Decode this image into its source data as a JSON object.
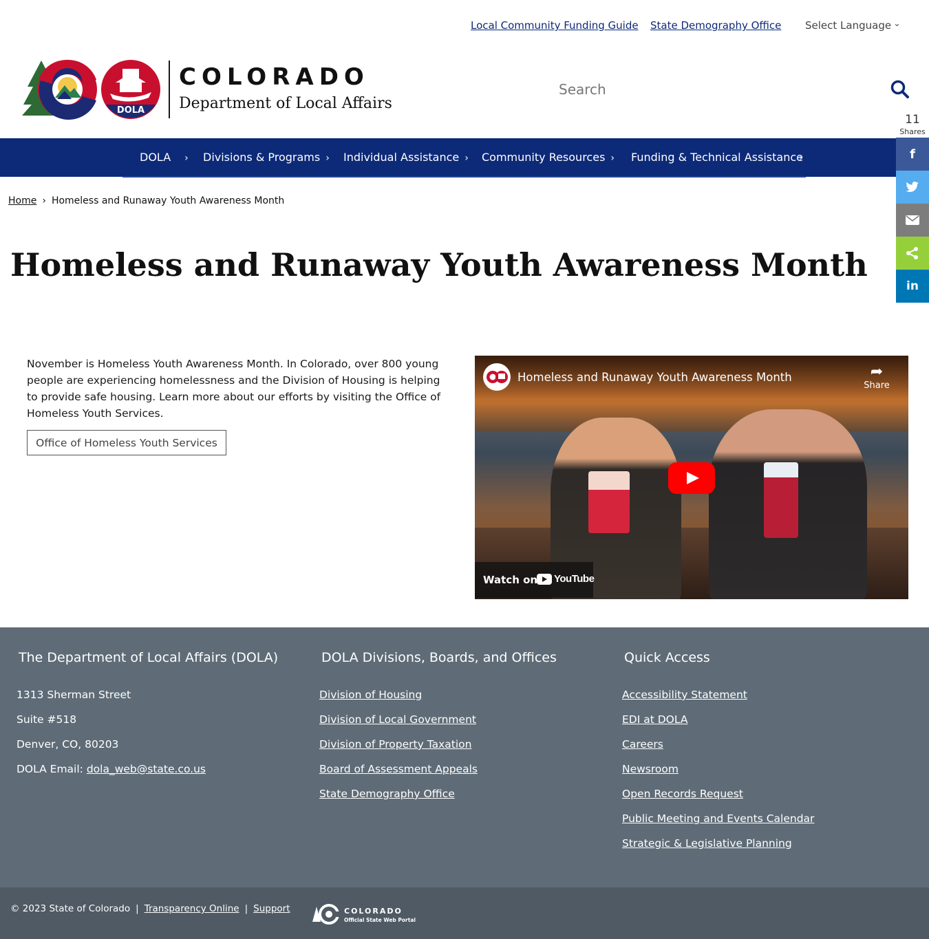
{
  "utility": {
    "link1": "Local Community Funding Guide",
    "link2": "State Demography Office",
    "language": "Select Language"
  },
  "header": {
    "brand_colorado": "COLORADO",
    "brand_department": "Department of Local Affairs",
    "badge_text": "DOLA",
    "search_placeholder": "Search"
  },
  "share": {
    "count": "11",
    "count_label": "Shares",
    "buttons": [
      {
        "name": "facebook",
        "color": "#3b5998",
        "glyph": "f"
      },
      {
        "name": "twitter",
        "color": "#55acee",
        "glyph": "t"
      },
      {
        "name": "email",
        "color": "#7d7d7d",
        "glyph": "✉"
      },
      {
        "name": "sharethis",
        "color": "#95d03a",
        "glyph": "<"
      },
      {
        "name": "linkedin",
        "color": "#0077b5",
        "glyph": "in"
      }
    ]
  },
  "nav": {
    "items": [
      {
        "label": "DOLA"
      },
      {
        "label": "Divisions & Programs"
      },
      {
        "label": "Individual Assistance"
      },
      {
        "label": "Community Resources"
      },
      {
        "label": "Funding & Technical Assistance"
      }
    ]
  },
  "breadcrumb": {
    "home": "Home",
    "current": "Homeless and Runaway Youth Awareness Month"
  },
  "page": {
    "title": "Homeless and Runaway Youth Awareness Month",
    "body": "November is Homeless Youth Awareness Month. In Colorado, over 800 young people are experiencing homelessness and the Division of Housing is helping to provide safe housing. Learn more about our efforts by visiting the Office of Homeless Youth Services.",
    "cta": "Office of Homeless Youth Services"
  },
  "video": {
    "title": "Homeless and Runaway Youth Awareness Month",
    "share": "Share",
    "watch_on": "Watch on",
    "youtube": "YouTube"
  },
  "footer": {
    "col1": {
      "heading": "The Department of Local Affairs (DOLA)",
      "address1": "1313 Sherman Street",
      "address2": "Suite  #518",
      "address3": "Denver, CO, 80203",
      "email_label": "DOLA Email: ",
      "email": "dola_web@state.co.us"
    },
    "col2": {
      "heading": "DOLA Divisions, Boards, and Offices",
      "links": [
        "Division of Housing",
        "Division of Local Government",
        "Division of Property Taxation",
        "Board of Assessment Appeals",
        "State Demography Office"
      ]
    },
    "col3": {
      "heading": "Quick Access",
      "links": [
        "Accessibility Statement",
        "EDI at DOLA",
        "Careers",
        "Newsroom",
        "Open Records Request",
        "Public Meeting and Events Calendar",
        "Strategic & Legislative Planning"
      ]
    }
  },
  "subfooter": {
    "copyright": "© 2023 State of Colorado",
    "transparency": "Transparency Online",
    "support": "Support",
    "portal_title": "COLORADO",
    "portal_sub": "Official State Web Portal"
  },
  "colors": {
    "nav_blue": "#0d2a78",
    "footer_gray": "#5f6c77",
    "subfooter_gray": "#4f5a64"
  }
}
